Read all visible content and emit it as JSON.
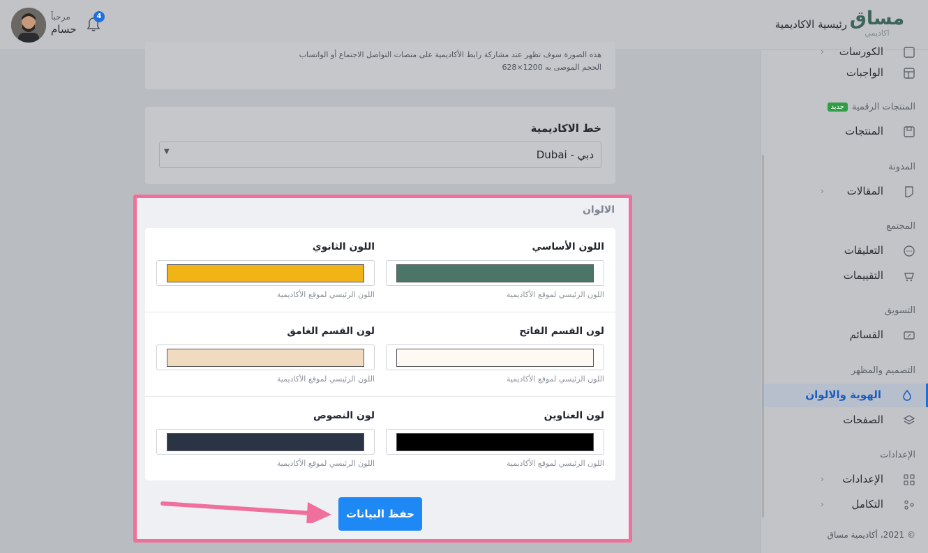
{
  "header": {
    "logo_main": "مساق",
    "logo_sub": "اكاديمي",
    "home_link": "رئيسية الاكاديمية",
    "greeting": "مرحباً",
    "user_name": "حسام",
    "notification_count": "4"
  },
  "sidebar": {
    "items": [
      {
        "label": "الكورسات",
        "icon": "course-icon"
      },
      {
        "label": "الواجبات",
        "icon": "layout-icon"
      },
      {
        "label": "المنتجات",
        "icon": "box-icon"
      },
      {
        "label": "المقالات",
        "icon": "document-icon"
      },
      {
        "label": "التعليقات",
        "icon": "chat-icon"
      },
      {
        "label": "التقييمات",
        "icon": "review-icon"
      },
      {
        "label": "القسائم",
        "icon": "ticket-icon"
      },
      {
        "label": "الهوية والالوان",
        "icon": "drop-icon"
      },
      {
        "label": "الصفحات",
        "icon": "layers-icon"
      },
      {
        "label": "الإعدادات",
        "icon": "grid-icon"
      },
      {
        "label": "التكامل",
        "icon": "nodes-icon"
      }
    ],
    "sections": {
      "digital_products": "المنتجات الرقمية",
      "new_badge": "جديد",
      "blog": "المدونة",
      "community": "المجتمع",
      "marketing": "التسويق",
      "design": "التصميم والمظهر",
      "settings": "الإعدادات"
    },
    "footer": "© 2021، أكاديمية مساق",
    "active_accent": "#1e6fd9"
  },
  "og_image": {
    "help_line1": "هذه الصورة سوف تظهر عند مشاركة رابط الأكاديمية على منصات التواصل الاجتماع أو الواتساب",
    "help_line2": "الحجم الموصى به 1200×628"
  },
  "font": {
    "title": "خط الاكاديمية",
    "selected": "دبي - Dubai"
  },
  "colors": {
    "title": "الالوان",
    "help": "اللون الرئيسي لموقع الأكاديمية",
    "primary": {
      "label": "اللون الأساسي",
      "value": "#4a7567"
    },
    "secondary": {
      "label": "اللون الثانوي",
      "value": "#f0b416"
    },
    "light_section": {
      "label": "لون القسم الفاتح",
      "value": "#fdfaf3"
    },
    "dark_section": {
      "label": "لون القسم الغامق",
      "value": "#f0dbc0"
    },
    "headings": {
      "label": "لون العناوين",
      "value": "#000000"
    },
    "text": {
      "label": "لون النصوص",
      "value": "#2b3445"
    }
  },
  "actions": {
    "save": "حفظ البيانات"
  },
  "annotation": {
    "highlight_color": "#f0709c"
  }
}
